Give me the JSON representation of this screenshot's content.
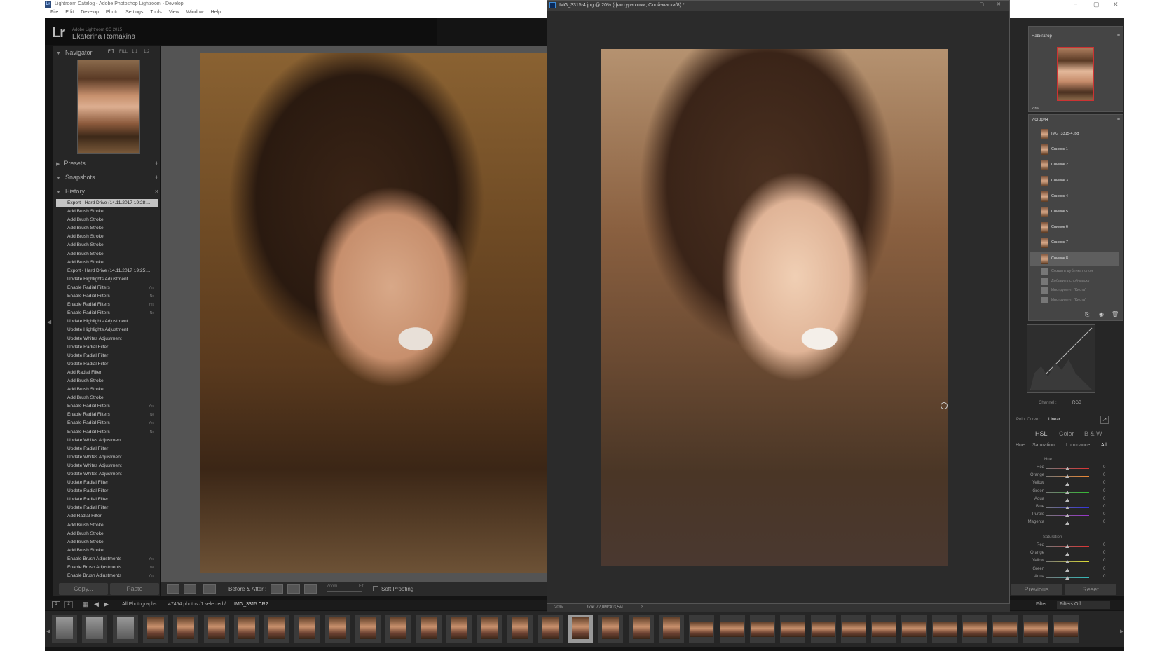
{
  "lightroom": {
    "window_title": "Lightroom Catalog - Adobe Photoshop Lightroom - Develop",
    "menu": [
      "File",
      "Edit",
      "Develop",
      "Photo",
      "Settings",
      "Tools",
      "View",
      "Window",
      "Help"
    ],
    "version": "Adobe Lightroom CC 2015",
    "user": "Ekaterina Romakina",
    "navigator": {
      "title": "Navigator",
      "zoom": [
        "FIT",
        "FILL",
        "1:1",
        "1:2"
      ]
    },
    "presets_label": "Presets",
    "snapshots_label": "Snapshots",
    "history_label": "History",
    "history": [
      {
        "label": "Export - Hard Drive (14.11.2017 19:28:...",
        "selected": true,
        "mark": ""
      },
      {
        "label": "Add Brush Stroke",
        "mark": ""
      },
      {
        "label": "Add Brush Stroke",
        "mark": ""
      },
      {
        "label": "Add Brush Stroke",
        "mark": ""
      },
      {
        "label": "Add Brush Stroke",
        "mark": ""
      },
      {
        "label": "Add Brush Stroke",
        "mark": ""
      },
      {
        "label": "Add Brush Stroke",
        "mark": ""
      },
      {
        "label": "Add Brush Stroke",
        "mark": ""
      },
      {
        "label": "Export - Hard Drive (14.11.2017 19:25:...",
        "mark": ""
      },
      {
        "label": "Update Highlights Adjustment",
        "mark": ""
      },
      {
        "label": "Enable Radial Filters",
        "mark": "Yes"
      },
      {
        "label": "Enable Radial Filters",
        "mark": "No"
      },
      {
        "label": "Enable Radial Filters",
        "mark": "Yes"
      },
      {
        "label": "Enable Radial Filters",
        "mark": "No"
      },
      {
        "label": "Update Highlights Adjustment",
        "mark": ""
      },
      {
        "label": "Update Highlights Adjustment",
        "mark": ""
      },
      {
        "label": "Update Whites Adjustment",
        "mark": ""
      },
      {
        "label": "Update Radial Filter",
        "mark": ""
      },
      {
        "label": "Update Radial Filter",
        "mark": ""
      },
      {
        "label": "Update Radial Filter",
        "mark": ""
      },
      {
        "label": "Add Radial Filter",
        "mark": ""
      },
      {
        "label": "Add Brush Stroke",
        "mark": ""
      },
      {
        "label": "Add Brush Stroke",
        "mark": ""
      },
      {
        "label": "Add Brush Stroke",
        "mark": ""
      },
      {
        "label": "Enable Radial Filters",
        "mark": "Yes"
      },
      {
        "label": "Enable Radial Filters",
        "mark": "No"
      },
      {
        "label": "Enable Radial Filters",
        "mark": "Yes"
      },
      {
        "label": "Enable Radial Filters",
        "mark": "No"
      },
      {
        "label": "Update Whites Adjustment",
        "mark": ""
      },
      {
        "label": "Update Radial Filter",
        "mark": ""
      },
      {
        "label": "Update Whites Adjustment",
        "mark": ""
      },
      {
        "label": "Update Whites Adjustment",
        "mark": ""
      },
      {
        "label": "Update Whites Adjustment",
        "mark": ""
      },
      {
        "label": "Update Radial Filter",
        "mark": ""
      },
      {
        "label": "Update Radial Filter",
        "mark": ""
      },
      {
        "label": "Update Radial Filter",
        "mark": ""
      },
      {
        "label": "Update Radial Filter",
        "mark": ""
      },
      {
        "label": "Add Radial Filter",
        "mark": ""
      },
      {
        "label": "Add Brush Stroke",
        "mark": ""
      },
      {
        "label": "Add Brush Stroke",
        "mark": ""
      },
      {
        "label": "Add Brush Stroke",
        "mark": ""
      },
      {
        "label": "Add Brush Stroke",
        "mark": ""
      },
      {
        "label": "Enable Brush Adjustments",
        "mark": "Yes"
      },
      {
        "label": "Enable Brush Adjustments",
        "mark": "No"
      },
      {
        "label": "Enable Brush Adjustments",
        "mark": "Yes"
      }
    ],
    "copy_label": "Copy...",
    "paste_label": "Paste",
    "toolbar": {
      "before_after": "Before & After :",
      "zoom": "Zoom",
      "zoom_value": "Fit",
      "soft_proofing": "Soft Proofing"
    },
    "filmstrip_bar": {
      "source": "All Photographs",
      "count": "47454 photos /1 selected /",
      "filename": "IMG_3315.CR2",
      "filter_label": "Filter :",
      "filter_value": "Filters Off"
    },
    "filmstrip_count": 34,
    "filmstrip_selected": 17,
    "right_panel": {
      "curve_channel": "Channel :",
      "curve_channel_value": "RGB",
      "point_curve": "Point Curve :",
      "point_curve_value": "Linear",
      "hsl_tabs": [
        "HSL",
        "Color",
        "B & W"
      ],
      "hsl_subtabs": [
        "Hue",
        "Saturation",
        "Luminance",
        "All"
      ],
      "hue_label": "Hue",
      "saturation_label": "Saturation",
      "hue_colors": [
        "Red",
        "Orange",
        "Yellow",
        "Green",
        "Aqua",
        "Blue",
        "Purple",
        "Magenta"
      ],
      "sat_colors": [
        "Red",
        "Orange",
        "Yellow",
        "Green",
        "Aqua"
      ],
      "hue_values": [
        "0",
        "0",
        "0",
        "0",
        "0",
        "0",
        "0",
        "0"
      ],
      "sat_values": [
        "0",
        "0",
        "0",
        "0",
        "0"
      ],
      "previous_label": "Previous",
      "reset_label": "Reset"
    }
  },
  "photoshop": {
    "window_title": "IMG_3315-4.jpg @ 20% (фактура кожи, Слой-маска/8) *",
    "status_zoom": "20%",
    "status_doc": "Док: 72,0M/303,5M",
    "navigator_title": "Навигатор",
    "navigator_zoom": "20%",
    "history_title": "История",
    "history": [
      {
        "label": "IMG_3315-4.jpg"
      },
      {
        "label": "Снимок 1"
      },
      {
        "label": "Снимок 2"
      },
      {
        "label": "Снимок 3"
      },
      {
        "label": "Снимок 4"
      },
      {
        "label": "Снимок 5"
      },
      {
        "label": "Снимок 6"
      },
      {
        "label": "Снимок 7"
      },
      {
        "label": "Снимок 8",
        "selected": true
      },
      {
        "label": "Создать дубликат слоя",
        "dim": true
      },
      {
        "label": "Добавить слой-маску",
        "dim": true
      },
      {
        "label": "Инструмент \"Кисть\"",
        "dim": true
      },
      {
        "label": "Инструмент \"Кисть\"",
        "dim": true
      }
    ]
  },
  "colors": {
    "lr_bg": "#141414",
    "panel": "#262626",
    "ps_bg": "#2b2b2b",
    "selected": "#c4c4c4"
  }
}
